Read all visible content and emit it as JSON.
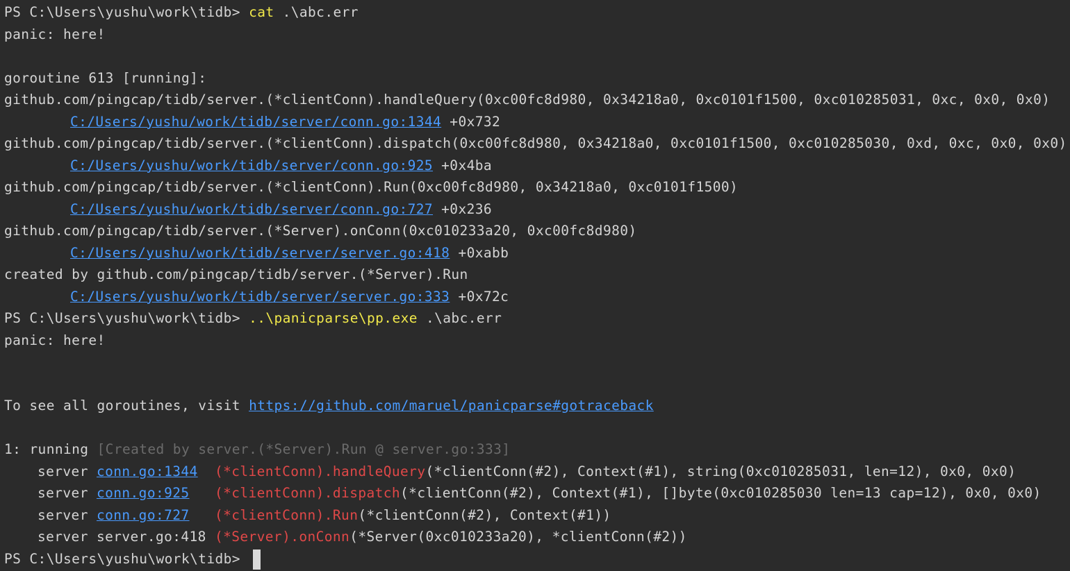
{
  "terminal": {
    "cmd1": {
      "prompt": "PS C:\\Users\\yushu\\work\\tidb> ",
      "command": "cat",
      "args": " .\\abc.err"
    },
    "panic1": "panic: here!",
    "goroutine": "goroutine 613 [running]:",
    "stack": [
      {
        "func": "github.com/pingcap/tidb/server.(*clientConn).handleQuery(0xc00fc8d980, 0x34218a0, 0xc0101f1500, 0xc010285031, 0xc, 0x0, 0x0)",
        "file": "C:/Users/yushu/work/tidb/server/conn.go:1344",
        "offset": " +0x732"
      },
      {
        "func": "github.com/pingcap/tidb/server.(*clientConn).dispatch(0xc00fc8d980, 0x34218a0, 0xc0101f1500, 0xc010285030, 0xd, 0xc, 0x0, 0x0)",
        "file": "C:/Users/yushu/work/tidb/server/conn.go:925",
        "offset": " +0x4ba"
      },
      {
        "func": "github.com/pingcap/tidb/server.(*clientConn).Run(0xc00fc8d980, 0x34218a0, 0xc0101f1500)",
        "file": "C:/Users/yushu/work/tidb/server/conn.go:727",
        "offset": " +0x236"
      },
      {
        "func": "github.com/pingcap/tidb/server.(*Server).onConn(0xc010233a20, 0xc00fc8d980)",
        "file": "C:/Users/yushu/work/tidb/server/server.go:418",
        "offset": " +0xabb"
      },
      {
        "func": "created by github.com/pingcap/tidb/server.(*Server).Run",
        "file": "C:/Users/yushu/work/tidb/server/server.go:333",
        "offset": " +0x72c"
      }
    ],
    "cmd2": {
      "prompt": "PS C:\\Users\\yushu\\work\\tidb> ",
      "command": "..\\panicparse\\pp.exe",
      "args": " .\\abc.err"
    },
    "panic2": "panic: here!",
    "visit": {
      "text": "To see all goroutines, visit ",
      "url": "https://github.com/maruel/panicparse#gotraceback"
    },
    "bucket": {
      "label": "1: running ",
      "created": "[Created by server.(*Server).Run @ server.go:333]"
    },
    "frames": [
      {
        "pkg": "server ",
        "file": "conn.go:1344",
        "pad": "  ",
        "recv": "(*clientConn).",
        "method": "handleQuery",
        "args": "(*clientConn(#2), Context(#1), string(0xc010285031, len=12), 0x0, 0x0)"
      },
      {
        "pkg": "server ",
        "file": "conn.go:925",
        "pad": "   ",
        "recv": "(*clientConn).",
        "method": "dispatch",
        "args": "(*clientConn(#2), Context(#1), []byte(0xc010285030 len=13 cap=12), 0x0, 0x0)"
      },
      {
        "pkg": "server ",
        "file": "conn.go:727",
        "pad": "   ",
        "recv": "(*clientConn).",
        "method": "Run",
        "args": "(*clientConn(#2), Context(#1))"
      },
      {
        "pkg": "server server.go:418",
        "file": "",
        "pad": " ",
        "recv": "(*Server).",
        "method": "onConn",
        "args": "(*Server(0xc010233a20), *clientConn(#2))"
      }
    ],
    "final_prompt": "PS C:\\Users\\yushu\\work\\tidb> "
  }
}
